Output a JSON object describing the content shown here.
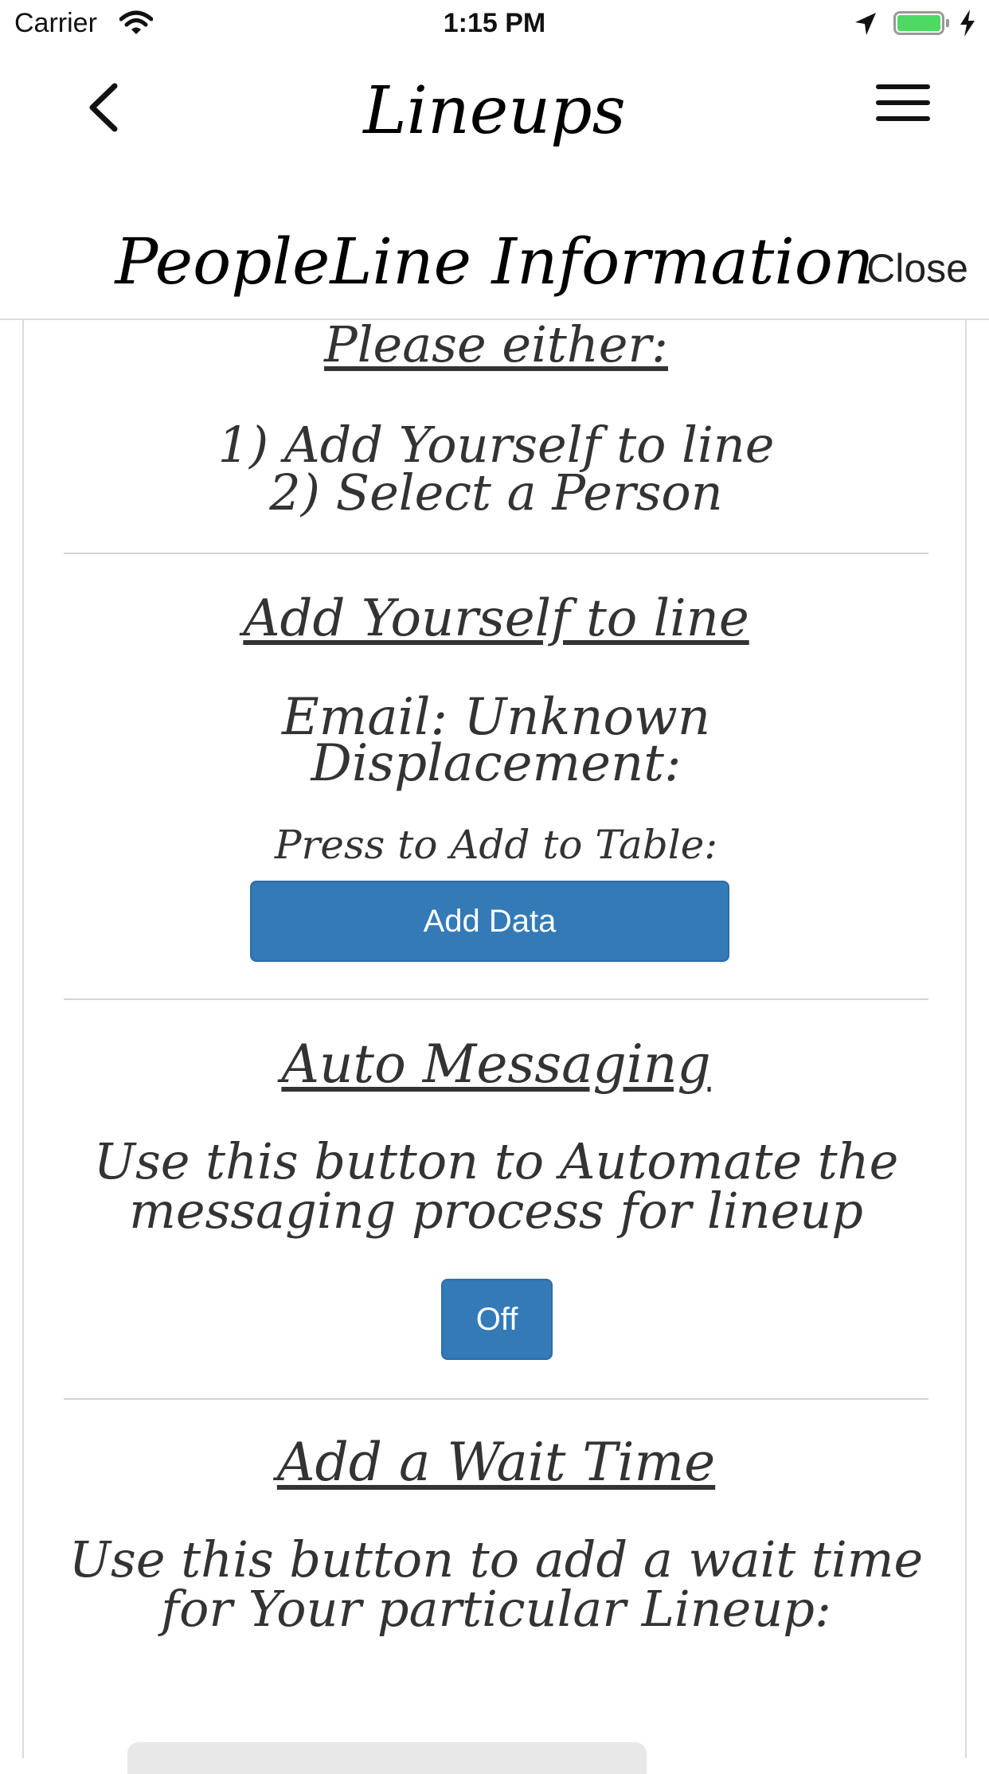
{
  "status_bar": {
    "carrier": "Carrier",
    "time": "1:15 PM",
    "battery_level": 1.0
  },
  "nav": {
    "title": "Lineups"
  },
  "sheet": {
    "title": "PeopleLine Information",
    "close_label": "Close"
  },
  "intro": {
    "heading": "Please either:",
    "line1": "1) Add Yourself to line",
    "line2": "2) Select a Person"
  },
  "add_yourself": {
    "heading": "Add Yourself to line ",
    "email": "Email: Unknown",
    "displacement": "Displacement:",
    "prompt": "Press to Add to Table:",
    "button_label": "Add Data"
  },
  "auto_messaging": {
    "heading": "Auto Messaging ",
    "line1": "Use this button to Automate the",
    "line2": "messaging process for lineup",
    "toggle_label": "Off"
  },
  "wait_time": {
    "heading": "Add a Wait Time ",
    "line1": "Use this button to add a wait time",
    "line2": "for Your particular Lineup:"
  },
  "colors": {
    "button": "#337ab7",
    "battery": "#4cd964"
  }
}
